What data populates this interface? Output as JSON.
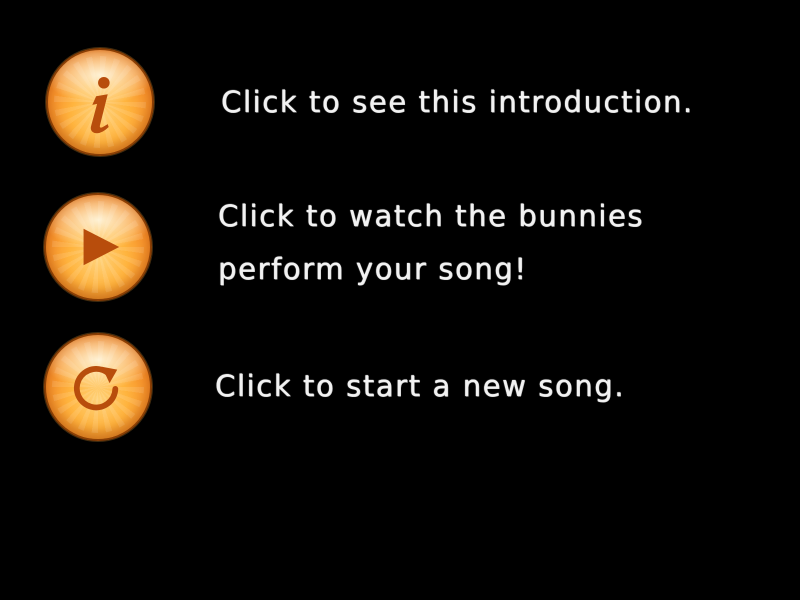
{
  "menu": {
    "items": [
      {
        "icon": "info-icon",
        "lines": [
          "Click to see this introduction."
        ]
      },
      {
        "icon": "play-icon",
        "lines": [
          "Click to watch the bunnies",
          "perform your song!"
        ]
      },
      {
        "icon": "refresh-icon",
        "lines": [
          "Click to start a new song."
        ]
      }
    ]
  },
  "colors": {
    "background": "#000000",
    "button_orange": "#f6902a",
    "button_highlight": "#ffd27a",
    "icon_brown": "#b84d0c",
    "text": "#f2f2f2"
  }
}
